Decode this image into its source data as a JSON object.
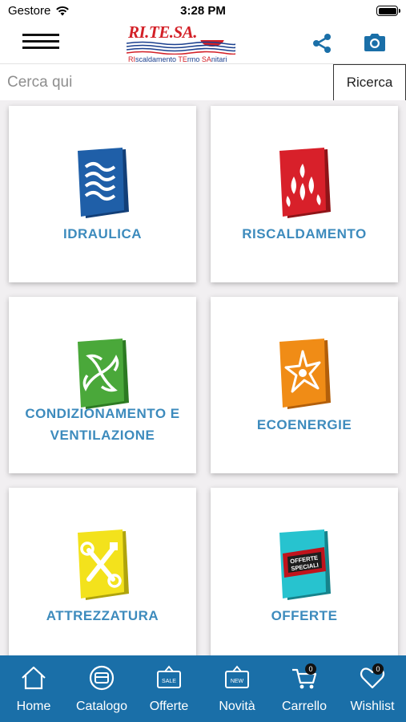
{
  "status_bar": {
    "carrier": "Gestore",
    "time": "3:28 PM"
  },
  "header": {
    "logo_name": "RI.TE.SA.",
    "logo_tagline_parts": [
      "RI",
      "scaldamento ",
      "TE",
      "rmo ",
      "SA",
      "nitari"
    ],
    "icons": {
      "menu": "hamburger-menu-icon",
      "share": "share-icon",
      "camera": "camera-icon"
    }
  },
  "search": {
    "placeholder": "Cerca qui",
    "value": "",
    "button_label": "Ricerca"
  },
  "categories": [
    {
      "label_line1": "IDRAULICA",
      "label_line2": "",
      "icon": "waves-icon",
      "color": "#1f5fa8"
    },
    {
      "label_line1": "RISCALDAMENTO",
      "label_line2": "",
      "icon": "flames-icon",
      "color": "#d8202a"
    },
    {
      "label_line1": "CONDIZIONAMENTO E",
      "label_line2": "VENTILAZIONE",
      "icon": "fan-icon",
      "color": "#4aa83a"
    },
    {
      "label_line1": "ECOENERGIE",
      "label_line2": "",
      "icon": "sun-icon",
      "color": "#f08c16"
    },
    {
      "label_line1": "ATTREZZATURA",
      "label_line2": "",
      "icon": "tools-icon",
      "color": "#f3e21c"
    },
    {
      "label_line1": "OFFERTE",
      "label_line2": "",
      "icon": "special-offer-icon",
      "color": "#27c3cf",
      "offer_text": [
        "OFFERTE",
        "SPECIALI"
      ]
    }
  ],
  "tabbar": {
    "items": [
      {
        "label": "Home",
        "icon": "home-icon"
      },
      {
        "label": "Catalogo",
        "icon": "catalog-icon"
      },
      {
        "label": "Offerte",
        "icon": "sale-sign-icon",
        "icon_text": "SALE"
      },
      {
        "label": "Novità",
        "icon": "new-sign-icon",
        "icon_text": "NEW"
      },
      {
        "label": "Carrello",
        "icon": "cart-icon",
        "badge": "0"
      },
      {
        "label": "Wishlist",
        "icon": "heart-icon",
        "badge": "0"
      }
    ]
  },
  "colors": {
    "accent": "#3d8bbd",
    "tabbar": "#1a6fa8",
    "logo_red": "#d32027",
    "logo_blue": "#1a3f8e"
  }
}
